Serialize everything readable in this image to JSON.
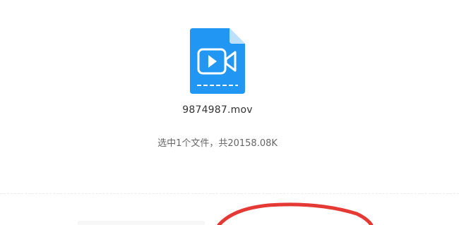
{
  "file": {
    "icon": "video-file-icon",
    "name": "9874987.mov"
  },
  "selection": {
    "summary": "选中1个文件，共20158.08K"
  },
  "colors": {
    "icon_blue": "#2196f3",
    "icon_fold": "#bfe0fb",
    "annotation_red": "#e53935",
    "text_dark": "#333333",
    "text_muted": "#666666"
  }
}
